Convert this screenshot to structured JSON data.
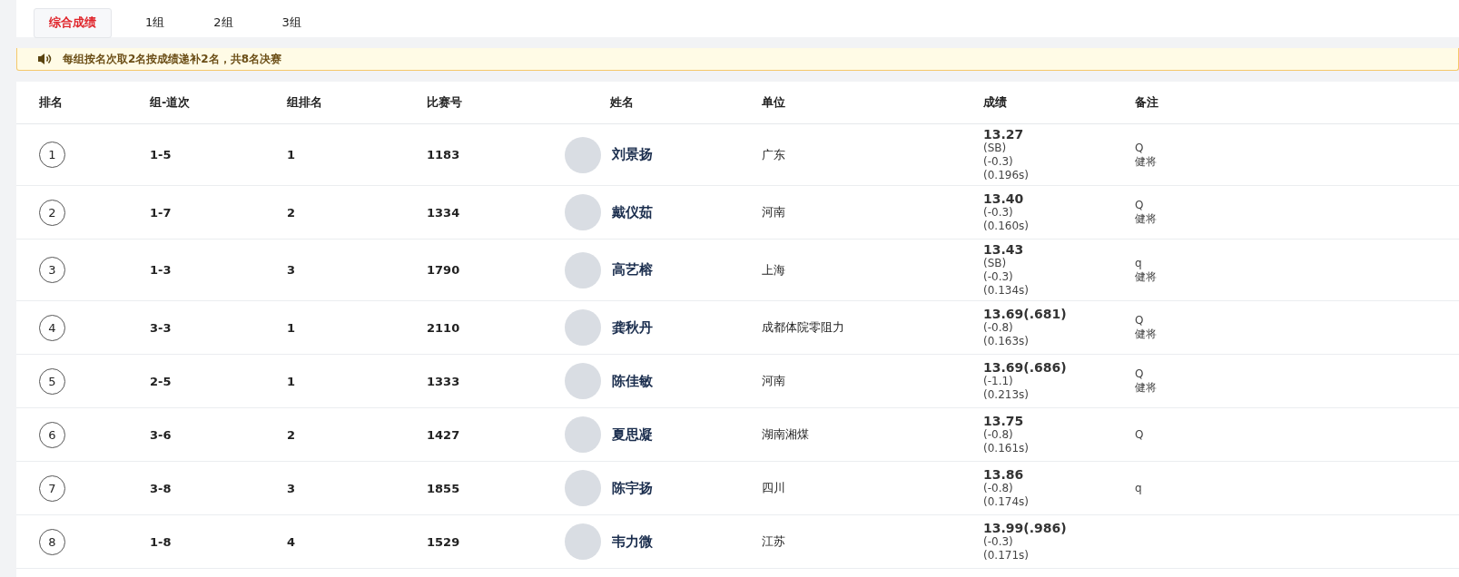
{
  "tabs": [
    {
      "label": "综合成绩",
      "selected": true
    },
    {
      "label": "1组",
      "selected": false
    },
    {
      "label": "2组",
      "selected": false
    },
    {
      "label": "3组",
      "selected": false
    }
  ],
  "notice": "每组按名次取2名按成绩递补2名，共8名决赛",
  "table": {
    "columns": [
      "排名",
      "组-道次",
      "组排名",
      "比赛号",
      "姓名",
      "单位",
      "成绩",
      "备注"
    ],
    "rows": [
      {
        "rank": "1",
        "lane": "1-5",
        "group_rank": "1",
        "bib": "1183",
        "name": "刘景扬",
        "unit": "广东",
        "time": "13.27",
        "notes": [
          "(SB)",
          "(-0.3)",
          "(0.196s)"
        ],
        "remarks": [
          "Q",
          "健将"
        ]
      },
      {
        "rank": "2",
        "lane": "1-7",
        "group_rank": "2",
        "bib": "1334",
        "name": "戴仪茹",
        "unit": "河南",
        "time": "13.40",
        "notes": [
          "(-0.3)",
          "(0.160s)"
        ],
        "remarks": [
          "Q",
          "健将"
        ]
      },
      {
        "rank": "3",
        "lane": "1-3",
        "group_rank": "3",
        "bib": "1790",
        "name": "高艺榕",
        "unit": "上海",
        "time": "13.43",
        "notes": [
          "(SB)",
          "(-0.3)",
          "(0.134s)"
        ],
        "remarks": [
          "q",
          "健将"
        ]
      },
      {
        "rank": "4",
        "lane": "3-3",
        "group_rank": "1",
        "bib": "2110",
        "name": "龚秋丹",
        "unit": "成都体院零阻力",
        "time": "13.69(.681)",
        "notes": [
          "(-0.8)",
          "(0.163s)"
        ],
        "remarks": [
          "Q",
          "健将"
        ]
      },
      {
        "rank": "5",
        "lane": "2-5",
        "group_rank": "1",
        "bib": "1333",
        "name": "陈佳敏",
        "unit": "河南",
        "time": "13.69(.686)",
        "notes": [
          "(-1.1)",
          "(0.213s)"
        ],
        "remarks": [
          "Q",
          "健将"
        ]
      },
      {
        "rank": "6",
        "lane": "3-6",
        "group_rank": "2",
        "bib": "1427",
        "name": "夏思凝",
        "unit": "湖南湘煤",
        "time": "13.75",
        "notes": [
          "(-0.8)",
          "(0.161s)"
        ],
        "remarks": [
          "Q"
        ]
      },
      {
        "rank": "7",
        "lane": "3-8",
        "group_rank": "3",
        "bib": "1855",
        "name": "陈宇扬",
        "unit": "四川",
        "time": "13.86",
        "notes": [
          "(-0.8)",
          "(0.174s)"
        ],
        "remarks": [
          "q"
        ]
      },
      {
        "rank": "8",
        "lane": "1-8",
        "group_rank": "4",
        "bib": "1529",
        "name": "韦力微",
        "unit": "江苏",
        "time": "13.99(.986)",
        "notes": [
          "(-0.3)",
          "(0.171s)"
        ],
        "remarks": []
      }
    ]
  }
}
